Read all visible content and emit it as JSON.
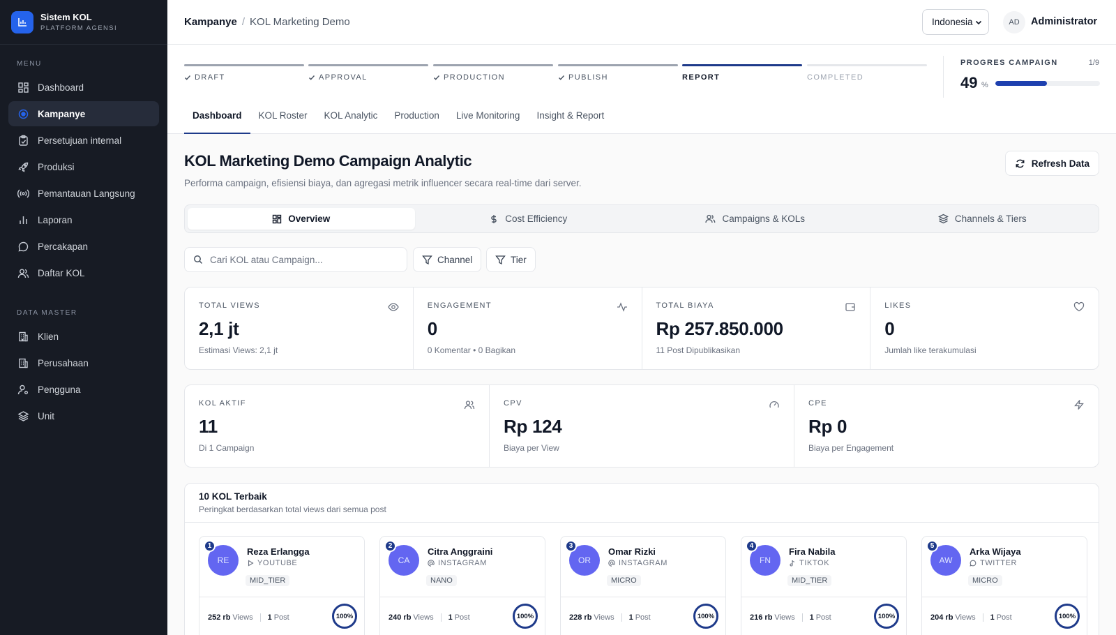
{
  "brand": {
    "title": "Sistem KOL",
    "subtitle": "PLATFORM AGENSI"
  },
  "sidebar": {
    "menu_label": "MENU",
    "menu": [
      {
        "label": "Dashboard",
        "icon": "dashboard-icon"
      },
      {
        "label": "Kampanye",
        "icon": "target-icon",
        "active": true
      },
      {
        "label": "Persetujuan internal",
        "icon": "clipboard-check-icon"
      },
      {
        "label": "Produksi",
        "icon": "rocket-icon"
      },
      {
        "label": "Pemantauan Langsung",
        "icon": "broadcast-icon"
      },
      {
        "label": "Laporan",
        "icon": "bar-chart-icon"
      },
      {
        "label": "Percakapan",
        "icon": "chat-icon"
      },
      {
        "label": "Daftar KOL",
        "icon": "users-icon"
      }
    ],
    "master_label": "DATA MASTER",
    "master": [
      {
        "label": "Klien",
        "icon": "building-icon"
      },
      {
        "label": "Perusahaan",
        "icon": "building-icon"
      },
      {
        "label": "Pengguna",
        "icon": "user-cog-icon"
      },
      {
        "label": "Unit",
        "icon": "layers-icon"
      }
    ]
  },
  "header": {
    "breadcrumb_parent": "Kampanye",
    "breadcrumb_sep": "/",
    "breadcrumb_current": "KOL Marketing Demo",
    "language": "Indonesia",
    "avatar_initials": "AD",
    "user_name": "Administrator"
  },
  "stepper": {
    "steps": [
      "DRAFT",
      "APPROVAL",
      "PRODUCTION",
      "PUBLISH",
      "REPORT",
      "COMPLETED"
    ],
    "done_count": 4,
    "current_index": 4
  },
  "progress": {
    "title": "PROGRES CAMPAIGN",
    "count": "1/9",
    "percent_label": "49",
    "percent_symbol": "%",
    "value": 0.49
  },
  "tabs": [
    "Dashboard",
    "KOL Roster",
    "KOL Analytic",
    "Production",
    "Live Monitoring",
    "Insight & Report"
  ],
  "page": {
    "title": "KOL Marketing Demo Campaign Analytic",
    "subtitle": "Performa campaign, efisiensi biaya, dan agregasi metrik influencer secara real-time dari server.",
    "refresh_label": "Refresh Data"
  },
  "segments": [
    {
      "label": "Overview",
      "icon": "grid-icon",
      "active": true
    },
    {
      "label": "Cost Efficiency",
      "icon": "dollar-icon"
    },
    {
      "label": "Campaigns & KOLs",
      "icon": "users-icon"
    },
    {
      "label": "Channels & Tiers",
      "icon": "layers-icon"
    }
  ],
  "filters": {
    "search_placeholder": "Cari KOL atau Campaign...",
    "channel_label": "Channel",
    "tier_label": "Tier"
  },
  "stats_row1": [
    {
      "label": "TOTAL VIEWS",
      "value": "2,1 jt",
      "desc": "Estimasi Views: 2,1 jt",
      "icon": "eye-icon"
    },
    {
      "label": "ENGAGEMENT",
      "value": "0",
      "desc": "0 Komentar • 0 Bagikan",
      "icon": "activity-icon"
    },
    {
      "label": "TOTAL BIAYA",
      "value": "Rp 257.850.000",
      "desc": "11 Post Dipublikasikan",
      "icon": "wallet-icon"
    },
    {
      "label": "LIKES",
      "value": "0",
      "desc": "Jumlah like terakumulasi",
      "icon": "heart-icon"
    }
  ],
  "stats_row2": [
    {
      "label": "KOL AKTIF",
      "value": "11",
      "desc": "Di 1 Campaign",
      "icon": "users-icon"
    },
    {
      "label": "CPV",
      "value": "Rp 124",
      "desc": "Biaya per View",
      "icon": "gauge-icon"
    },
    {
      "label": "CPE",
      "value": "Rp 0",
      "desc": "Biaya per Engagement",
      "icon": "zap-icon"
    }
  ],
  "top_kol": {
    "title": "10 KOL Terbaik",
    "subtitle": "Peringkat berdasarkan total views dari semua post",
    "views_unit": "Views",
    "post_unit": "Post",
    "items": [
      {
        "rank": "1",
        "initials": "RE",
        "name": "Reza Erlangga",
        "channel": "YOUTUBE",
        "channel_icon": "play-icon",
        "tier": "MID_TIER",
        "views": "252 rb",
        "posts": "1",
        "score": "100%"
      },
      {
        "rank": "2",
        "initials": "CA",
        "name": "Citra Anggraini",
        "channel": "INSTAGRAM",
        "channel_icon": "at-icon",
        "tier": "NANO",
        "views": "240 rb",
        "posts": "1",
        "score": "100%"
      },
      {
        "rank": "3",
        "initials": "OR",
        "name": "Omar Rizki",
        "channel": "INSTAGRAM",
        "channel_icon": "at-icon",
        "tier": "MICRO",
        "views": "228 rb",
        "posts": "1",
        "score": "100%"
      },
      {
        "rank": "4",
        "initials": "FN",
        "name": "Fira Nabila",
        "channel": "TIKTOK",
        "channel_icon": "music-icon",
        "tier": "MID_TIER",
        "views": "216 rb",
        "posts": "1",
        "score": "100%"
      },
      {
        "rank": "5",
        "initials": "AW",
        "name": "Arka Wijaya",
        "channel": "TWITTER",
        "channel_icon": "message-icon",
        "tier": "MICRO",
        "views": "204 rb",
        "posts": "1",
        "score": "100%"
      }
    ]
  },
  "colors": {
    "sidebar_bg": "#171b24",
    "accent": "#1e3a8a",
    "avatar": "#6366f1"
  }
}
